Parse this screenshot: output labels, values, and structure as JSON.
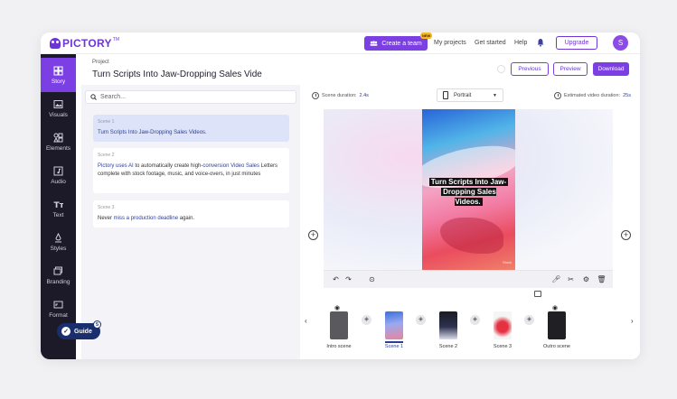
{
  "brand": {
    "name": "PICTORY",
    "tm": "TM",
    "accent": "#7b3fe4",
    "sidebar_bg": "#1c1a29"
  },
  "topbar": {
    "create_team_label": "Create a team",
    "new_badge": "NEW",
    "links": [
      "My projects",
      "Get started",
      "Help"
    ],
    "upgrade_label": "Upgrade",
    "avatar_initial": "S"
  },
  "sidebar": {
    "items": [
      {
        "label": "Story",
        "icon": "story-icon",
        "active": true
      },
      {
        "label": "Visuals",
        "icon": "image-icon"
      },
      {
        "label": "Elements",
        "icon": "elements-icon"
      },
      {
        "label": "Audio",
        "icon": "music-icon"
      },
      {
        "label": "Text",
        "icon": "text-icon"
      },
      {
        "label": "Styles",
        "icon": "styles-icon"
      },
      {
        "label": "Branding",
        "icon": "branding-icon"
      },
      {
        "label": "Format",
        "icon": "format-icon"
      }
    ],
    "guide_label": "Guide",
    "guide_count": "5"
  },
  "header": {
    "project_label": "Project",
    "title": "Turn Scripts Into Jaw-Dropping Sales Vide",
    "previous_label": "Previous",
    "preview_label": "Preview",
    "download_label": "Download"
  },
  "script": {
    "search_placeholder": "Search...",
    "scenes": [
      {
        "label": "Scene 1",
        "text": "Turn Scripts Into Jaw-Dropping Sales Videos."
      },
      {
        "label": "Scene 2",
        "t1": "Pictory uses AI",
        "t2": " to automatically create high-",
        "t3": "conversion Video Sales",
        "t4": " Letters complete with stock footage, music, and voice-overs, in just minutes"
      },
      {
        "label": "Scene 3",
        "t1": "Never ",
        "t2": "miss a production deadline",
        "t3": " again."
      }
    ]
  },
  "editor": {
    "scene_duration_label": "Scene duration:",
    "scene_duration_value": "2.4s",
    "orientation": "Portrait",
    "est_duration_label": "Estimated video duration:",
    "est_duration_value": "25s",
    "caption_line1": "Turn Scripts Into Jaw-",
    "caption_line2": "Dropping Sales Videos.",
    "watermark": "Stock"
  },
  "filmstrip": {
    "scenes": [
      {
        "label": "Intro scene",
        "hidden": true
      },
      {
        "label": "Scene 1",
        "active": true
      },
      {
        "label": "Scene 2"
      },
      {
        "label": "Scene 3"
      },
      {
        "label": "Outro scene",
        "hidden": true
      }
    ]
  }
}
